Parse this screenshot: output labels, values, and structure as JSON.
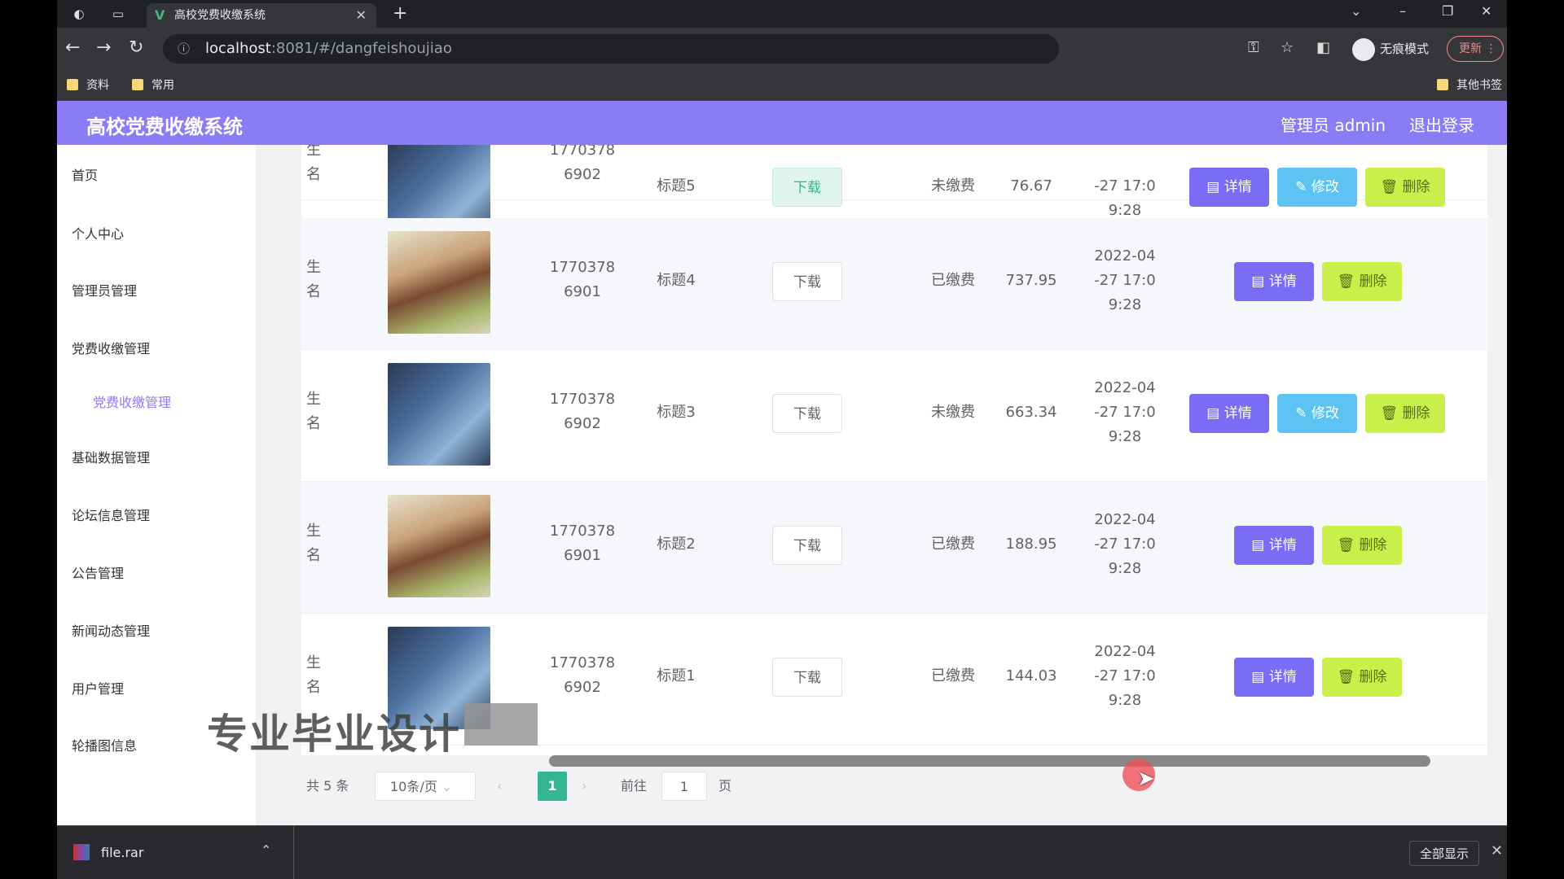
{
  "browser": {
    "tab_title": "高校党费收缴系统",
    "url_host": "localhost",
    "url_path": ":8081/#/dangfeishoujiao",
    "incognito_label": "无痕模式",
    "update_label": "更新",
    "bookmarks": [
      "资料",
      "常用"
    ],
    "other_bookmarks": "其他书签"
  },
  "header": {
    "system_title": "高校党费收缴系统",
    "user_label": "管理员 admin",
    "logout_label": "退出登录"
  },
  "sidebar": {
    "items": [
      "首页",
      "个人中心",
      "管理员管理",
      "党费收缴管理",
      "党费收缴管理",
      "基础数据管理",
      "论坛信息管理",
      "公告管理",
      "新闻动态管理",
      "用户管理",
      "轮播图信息"
    ]
  },
  "table": {
    "rows": [
      {
        "name_cut": "生名",
        "phone_a": "1770378",
        "phone_b": "6902",
        "title": "标题5",
        "download": "下载",
        "status": "未缴费",
        "amount": "76.67",
        "date_a": "",
        "date_b": "-27 17:0",
        "date_c": "9:28",
        "detail": "详情",
        "edit": "修改",
        "delete": "删除",
        "avatar": "blue"
      },
      {
        "name_cut": "生名",
        "phone_a": "1770378",
        "phone_b": "6901",
        "title": "标题4",
        "download": "下载",
        "status": "已缴费",
        "amount": "737.95",
        "date_a": "2022-04",
        "date_b": "-27 17:0",
        "date_c": "9:28",
        "detail": "详情",
        "delete": "删除",
        "avatar": "girl"
      },
      {
        "name_cut": "生名",
        "phone_a": "1770378",
        "phone_b": "6902",
        "title": "标题3",
        "download": "下载",
        "status": "未缴费",
        "amount": "663.34",
        "date_a": "2022-04",
        "date_b": "-27 17:0",
        "date_c": "9:28",
        "detail": "详情",
        "edit": "修改",
        "delete": "删除",
        "avatar": "blue"
      },
      {
        "name_cut": "生名",
        "phone_a": "1770378",
        "phone_b": "6901",
        "title": "标题2",
        "download": "下载",
        "status": "已缴费",
        "amount": "188.95",
        "date_a": "2022-04",
        "date_b": "-27 17:0",
        "date_c": "9:28",
        "detail": "详情",
        "delete": "删除",
        "avatar": "girl"
      },
      {
        "name_cut": "生名",
        "phone_a": "1770378",
        "phone_b": "6902",
        "title": "标题1",
        "download": "下载",
        "status": "已缴费",
        "amount": "144.03",
        "date_a": "2022-04",
        "date_b": "-27 17:0",
        "date_c": "9:28",
        "detail": "详情",
        "delete": "删除",
        "avatar": "blue"
      }
    ]
  },
  "pager": {
    "total": "共 5 条",
    "page_size": "10条/页",
    "current": "1",
    "goto_prefix": "前往",
    "goto_value": "1",
    "goto_suffix": "页"
  },
  "overlay": {
    "watermark": "专业毕业设计"
  },
  "downloads": {
    "file": "file.rar",
    "show_all": "全部显示"
  }
}
